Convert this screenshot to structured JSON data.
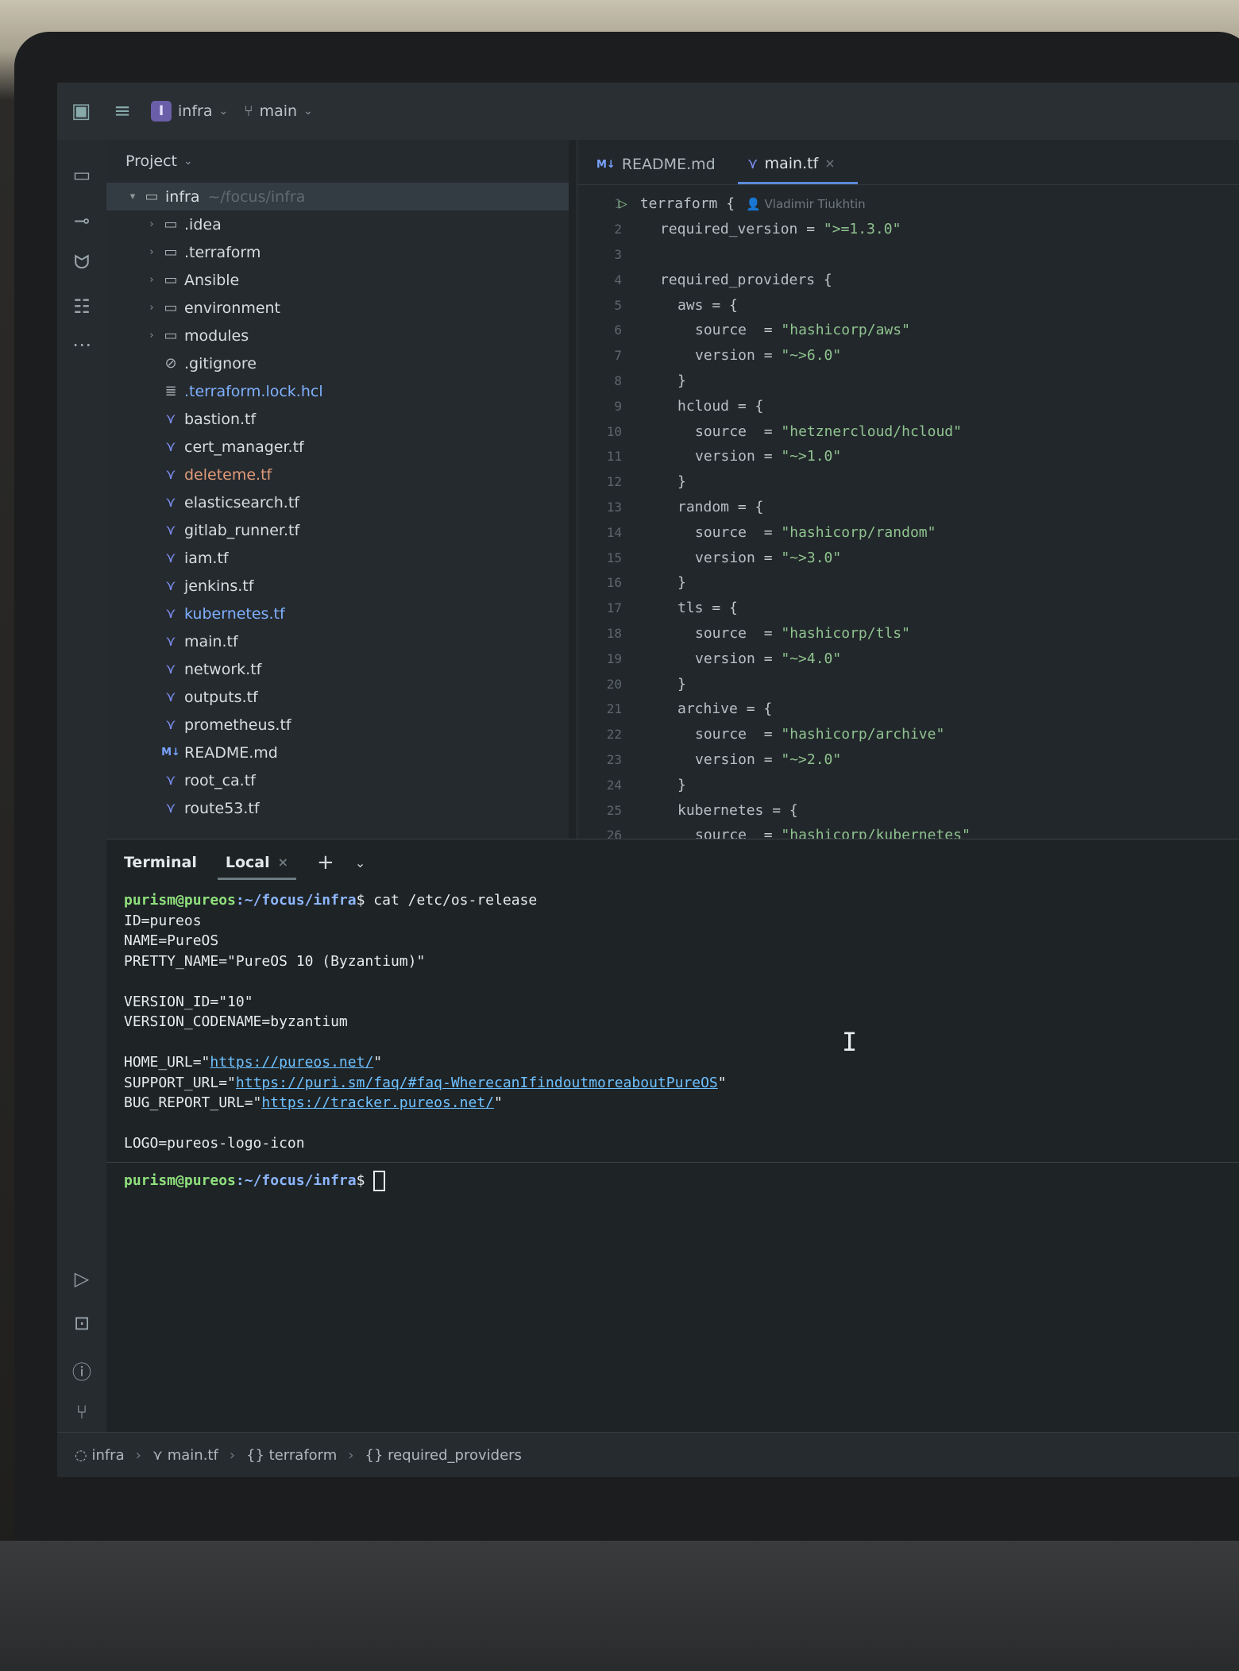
{
  "titlebar": {
    "project_initial": "I",
    "project_name": "infra",
    "branch": "main"
  },
  "project_pane": {
    "title": "Project",
    "root": {
      "name": "infra",
      "path": "~/focus/infra"
    },
    "items": [
      {
        "name": ".idea",
        "type": "folder"
      },
      {
        "name": ".terraform",
        "type": "folder"
      },
      {
        "name": "Ansible",
        "type": "folder"
      },
      {
        "name": "environment",
        "type": "folder"
      },
      {
        "name": "modules",
        "type": "folder"
      },
      {
        "name": ".gitignore",
        "type": "ignore"
      },
      {
        "name": ".terraform.lock.hcl",
        "type": "text",
        "status": "modified"
      },
      {
        "name": "bastion.tf",
        "type": "tf"
      },
      {
        "name": "cert_manager.tf",
        "type": "tf"
      },
      {
        "name": "deleteme.tf",
        "type": "tf",
        "status": "new"
      },
      {
        "name": "elasticsearch.tf",
        "type": "tf"
      },
      {
        "name": "gitlab_runner.tf",
        "type": "tf"
      },
      {
        "name": "iam.tf",
        "type": "tf"
      },
      {
        "name": "jenkins.tf",
        "type": "tf"
      },
      {
        "name": "kubernetes.tf",
        "type": "tf",
        "status": "modified"
      },
      {
        "name": "main.tf",
        "type": "tf"
      },
      {
        "name": "network.tf",
        "type": "tf"
      },
      {
        "name": "outputs.tf",
        "type": "tf"
      },
      {
        "name": "prometheus.tf",
        "type": "tf"
      },
      {
        "name": "README.md",
        "type": "md"
      },
      {
        "name": "root_ca.tf",
        "type": "tf"
      },
      {
        "name": "route53.tf",
        "type": "tf"
      }
    ]
  },
  "editor": {
    "tabs": [
      {
        "icon": "M↓",
        "label": "README.md",
        "active": false
      },
      {
        "icon": "tf",
        "label": "main.tf",
        "active": true
      }
    ],
    "author_hint": "Vladimir Tiukhtin",
    "lines": [
      {
        "n": "1",
        "indent": 0,
        "key": "terraform",
        "op": " {",
        "val": ""
      },
      {
        "n": "2",
        "indent": 1,
        "key": "required_version",
        "op": " = ",
        "val": "\">=1.3.0\""
      },
      {
        "n": "3",
        "indent": 0,
        "key": "",
        "op": "",
        "val": ""
      },
      {
        "n": "4",
        "indent": 1,
        "key": "required_providers",
        "op": " {",
        "val": ""
      },
      {
        "n": "5",
        "indent": 2,
        "key": "aws",
        "op": " = {",
        "val": ""
      },
      {
        "n": "6",
        "indent": 3,
        "key": "source",
        "op": "  = ",
        "val": "\"hashicorp/aws\""
      },
      {
        "n": "7",
        "indent": 3,
        "key": "version",
        "op": " = ",
        "val": "\"~>6.0\""
      },
      {
        "n": "8",
        "indent": 2,
        "key": "}",
        "op": "",
        "val": ""
      },
      {
        "n": "9",
        "indent": 2,
        "key": "hcloud",
        "op": " = {",
        "val": ""
      },
      {
        "n": "10",
        "indent": 3,
        "key": "source",
        "op": "  = ",
        "val": "\"hetznercloud/hcloud\""
      },
      {
        "n": "11",
        "indent": 3,
        "key": "version",
        "op": " = ",
        "val": "\"~>1.0\""
      },
      {
        "n": "12",
        "indent": 2,
        "key": "}",
        "op": "",
        "val": ""
      },
      {
        "n": "13",
        "indent": 2,
        "key": "random",
        "op": " = {",
        "val": ""
      },
      {
        "n": "14",
        "indent": 3,
        "key": "source",
        "op": "  = ",
        "val": "\"hashicorp/random\""
      },
      {
        "n": "15",
        "indent": 3,
        "key": "version",
        "op": " = ",
        "val": "\"~>3.0\""
      },
      {
        "n": "16",
        "indent": 2,
        "key": "}",
        "op": "",
        "val": ""
      },
      {
        "n": "17",
        "indent": 2,
        "key": "tls",
        "op": " = {",
        "val": ""
      },
      {
        "n": "18",
        "indent": 3,
        "key": "source",
        "op": "  = ",
        "val": "\"hashicorp/tls\""
      },
      {
        "n": "19",
        "indent": 3,
        "key": "version",
        "op": " = ",
        "val": "\"~>4.0\""
      },
      {
        "n": "20",
        "indent": 2,
        "key": "}",
        "op": "",
        "val": ""
      },
      {
        "n": "21",
        "indent": 2,
        "key": "archive",
        "op": " = {",
        "val": ""
      },
      {
        "n": "22",
        "indent": 3,
        "key": "source",
        "op": "  = ",
        "val": "\"hashicorp/archive\""
      },
      {
        "n": "23",
        "indent": 3,
        "key": "version",
        "op": " = ",
        "val": "\"~>2.0\""
      },
      {
        "n": "24",
        "indent": 2,
        "key": "}",
        "op": "",
        "val": ""
      },
      {
        "n": "25",
        "indent": 2,
        "key": "kubernetes",
        "op": " = {",
        "val": ""
      },
      {
        "n": "26",
        "indent": 3,
        "key": "source",
        "op": "  = ",
        "val": "\"hashicorp/kubernetes\""
      }
    ]
  },
  "terminal": {
    "title": "Terminal",
    "tab_label": "Local",
    "prompt_user": "purism@pureos",
    "prompt_cwd": ":~/focus/infra",
    "prompt_symbol": "$ ",
    "command": "cat /etc/os-release",
    "output": [
      {
        "text": "ID=pureos"
      },
      {
        "text": "NAME=PureOS"
      },
      {
        "text": "PRETTY_NAME=\"PureOS 10 (Byzantium)\""
      },
      {
        "text": ""
      },
      {
        "text": "VERSION_ID=\"10\""
      },
      {
        "text": "VERSION_CODENAME=byzantium"
      },
      {
        "text": ""
      },
      {
        "pre": "HOME_URL=\"",
        "link": "https://pureos.net/",
        "post": "\""
      },
      {
        "pre": "SUPPORT_URL=\"",
        "link": "https://puri.sm/faq/#faq-WherecanIfindoutmoreaboutPureOS",
        "post": "\""
      },
      {
        "pre": "BUG_REPORT_URL=\"",
        "link": "https://tracker.pureos.net/",
        "post": "\""
      },
      {
        "text": ""
      },
      {
        "text": "LOGO=pureos-logo-icon"
      }
    ]
  },
  "statusbar": {
    "crumbs": [
      "infra",
      "main.tf",
      "terraform",
      "required_providers"
    ]
  },
  "colors": {
    "accent": "#5b8bd8",
    "prompt": "#8fe07d",
    "string": "#8fc38f"
  }
}
